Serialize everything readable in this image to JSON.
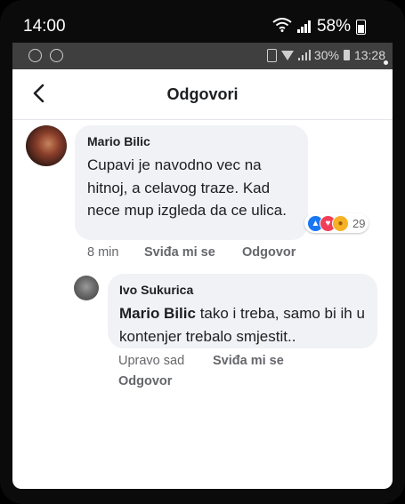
{
  "outer_status": {
    "time": "14:00",
    "battery": "58%"
  },
  "inner_status": {
    "signal": "30%",
    "time": "13:28"
  },
  "header": {
    "title": "Odgovori"
  },
  "comment": {
    "author": "Mario Bilic",
    "text": "Cupavi je navodno vec na hitnoj, a celavog traze. Kad nece mup izgleda da ce ulica.",
    "reaction_count": "29",
    "time": "8 min",
    "like_label": "Sviđa mi se",
    "reply_label": "Odgovor"
  },
  "reply": {
    "author": "Ivo Sukurica",
    "mention": "Mario Bilic",
    "text": " tako i treba, samo bi ih u kontenjer trebalo smjestit..",
    "time": "Upravo sad",
    "like_label": "Sviđa mi se",
    "reply_label": "Odgovor"
  },
  "colors": {
    "bubble": "#f0f2f5",
    "meta_text": "#65676b",
    "like": "#1877f2",
    "love": "#f33e58"
  },
  "icons": [
    "wifi-icon",
    "signal-icon",
    "battery-icon",
    "whatsapp-icon",
    "vibrate-icon",
    "back-arrow-icon",
    "like-reaction-icon",
    "love-reaction-icon",
    "care-reaction-icon"
  ]
}
